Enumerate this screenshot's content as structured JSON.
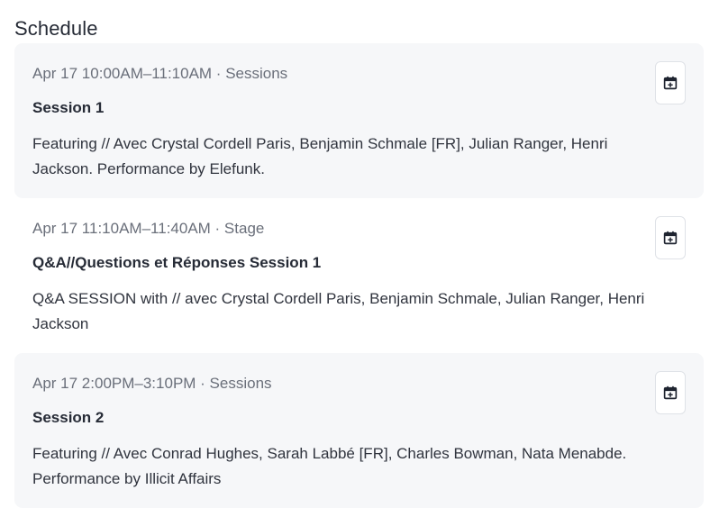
{
  "heading": "Schedule",
  "sessions": [
    {
      "meta": "Apr 17 10:00AM–11:10AM · Sessions",
      "title": "Session 1",
      "description": "Featuring // Avec Crystal Cordell Paris, Benjamin Schmale [FR], Julian Ranger, Henri Jackson. Performance by Elefunk.",
      "action_icon": "calendar-add-icon"
    },
    {
      "meta": "Apr 17 11:10AM–11:40AM · Stage",
      "title": "Q&A//Questions et Réponses Session 1",
      "description": "Q&A SESSION with // avec Crystal Cordell Paris, Benjamin Schmale, Julian Ranger, Henri Jackson",
      "action_icon": "calendar-add-icon"
    },
    {
      "meta": "Apr 17 2:00PM–3:10PM · Sessions",
      "title": "Session 2",
      "description": "Featuring // Avec Conrad Hughes, Sarah Labbé [FR], Charles Bowman, Nata Menabde. Performance by Illicit Affairs",
      "action_icon": "calendar-add-icon"
    }
  ],
  "colors": {
    "card_background": "#f6f7f9",
    "meta_text": "#6a6f7a",
    "title_text": "#262b36",
    "button_border": "#dfe2e7"
  }
}
